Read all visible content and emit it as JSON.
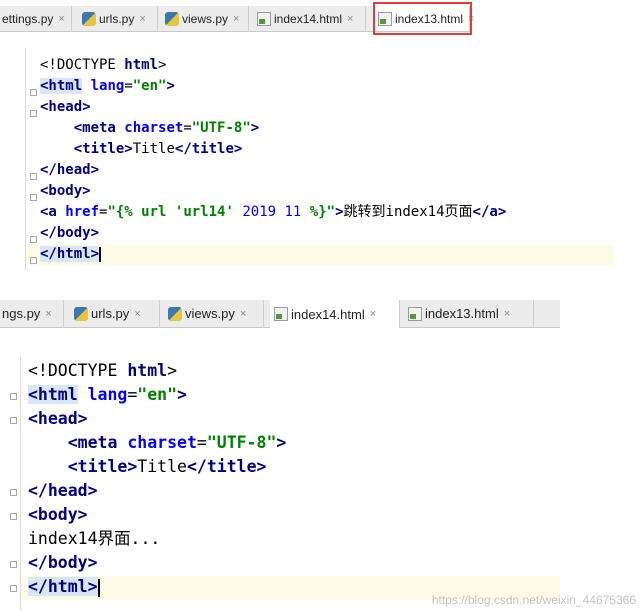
{
  "top": {
    "tabs": [
      {
        "label": "ettings.py",
        "icon": "python-file-icon"
      },
      {
        "label": "urls.py",
        "icon": "python-file-icon"
      },
      {
        "label": "views.py",
        "icon": "python-file-icon"
      },
      {
        "label": "index14.html",
        "icon": "html-file-icon"
      },
      {
        "label": "index13.html",
        "icon": "html-file-icon"
      }
    ],
    "close_glyph": "×",
    "code": {
      "l1_doctype": "<!DOCTYPE ",
      "l1_html": "html",
      "l1_close": ">",
      "l2_open": "<html",
      "l2_attr": " lang",
      "l2_eq": "=",
      "l2_val": "\"en\"",
      "l2_close": ">",
      "l3": "<head>",
      "l4_open": "<meta",
      "l4_attr": " charset",
      "l4_eq": "=",
      "l4_val": "\"UTF-8\"",
      "l4_close": ">",
      "l5_open": "<title>",
      "l5_text": "Title",
      "l5_close": "</title>",
      "l6": "</head>",
      "l7": "<body>",
      "l8_open": "<a",
      "l8_attr": " href",
      "l8_eq": "=",
      "l8_q1": "\"{% url ",
      "l8_name": "'url14'",
      "l8_sp1": " ",
      "l8_n1": "2019",
      "l8_sp2": " ",
      "l8_n2": "11",
      "l8_q2": " %}\"",
      "l8_gt": ">",
      "l8_text": "跳转到index14页面",
      "l8_close": "</a>",
      "l9": "</body>",
      "l10": "</html>"
    }
  },
  "bottom": {
    "tabs": [
      {
        "label": "ngs.py",
        "icon": "python-file-icon"
      },
      {
        "label": "urls.py",
        "icon": "python-file-icon"
      },
      {
        "label": "views.py",
        "icon": "python-file-icon"
      },
      {
        "label": "index14.html",
        "icon": "html-file-icon"
      },
      {
        "label": "index13.html",
        "icon": "html-file-icon"
      }
    ],
    "close_glyph": "×",
    "code": {
      "l1_doctype": "<!DOCTYPE ",
      "l1_html": "html",
      "l1_close": ">",
      "l2_open": "<html",
      "l2_attr": " lang",
      "l2_eq": "=",
      "l2_val": "\"en\"",
      "l2_close": ">",
      "l3": "<head>",
      "l4_open": "<meta",
      "l4_attr": " charset",
      "l4_eq": "=",
      "l4_val": "\"UTF-8\"",
      "l4_close": ">",
      "l5_open": "<title>",
      "l5_text": "Title",
      "l5_close": "</title>",
      "l6": "</head>",
      "l7": "<body>",
      "l8_text": "index14界面...",
      "l9": "</body>",
      "l10": "</html>"
    }
  },
  "watermark": "https://blog.csdn.net/weixin_44675366",
  "colors": {
    "tag": "#000080",
    "attr": "#0000ff",
    "string": "#008000",
    "highlight_box": "#e53a3a"
  }
}
